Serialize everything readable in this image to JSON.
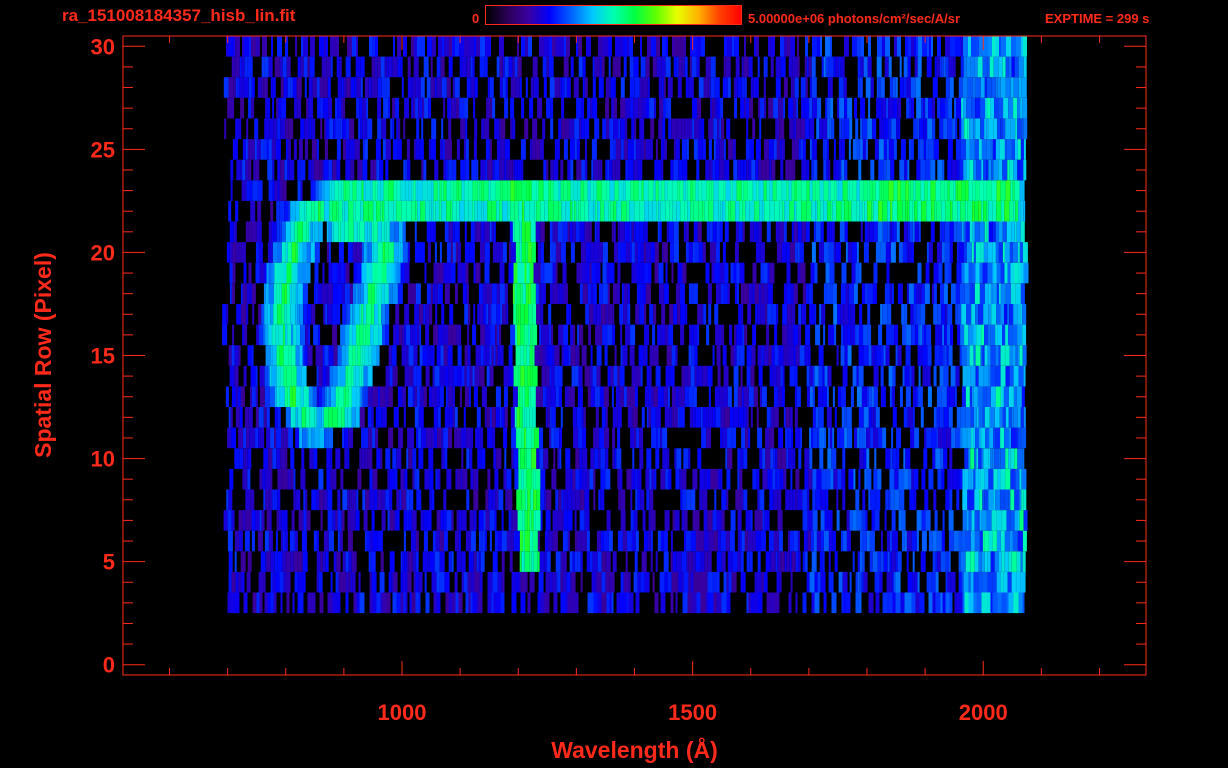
{
  "header": {
    "file_title": "ra_151008184357_hisb_lin.fit",
    "colorbar_min": "0",
    "colorbar_max": "5.00000e+06 photons/cm²/sec/A/sr",
    "exptime": "EXPTIME = 299 s"
  },
  "colors": {
    "axis": "#ff2a1a",
    "background": "#000000",
    "colormap": [
      "#000000",
      "#2a0055",
      "#3a00a0",
      "#0000ff",
      "#0060ff",
      "#00c8ff",
      "#00ffb0",
      "#00ff40",
      "#60ff00",
      "#e8ff00",
      "#ffb000",
      "#ff4000",
      "#ff0000"
    ]
  },
  "chart_data": {
    "type": "heatmap",
    "xlabel": "Wavelength (Å)",
    "ylabel": "Spatial Row (Pixel)",
    "xlim": [
      520,
      2280
    ],
    "ylim": [
      -0.5,
      30.5
    ],
    "x_ticks": [
      1000,
      1500,
      2000
    ],
    "y_ticks": [
      0,
      5,
      10,
      15,
      20,
      25,
      30
    ],
    "x_tick_labels": [
      "1000",
      "1500",
      "2000"
    ],
    "y_tick_labels": [
      "0",
      "5",
      "10",
      "15",
      "20",
      "25",
      "30"
    ],
    "value_range": [
      0,
      5000000
    ],
    "data_extent_x": [
      690,
      2070
    ],
    "data_rows": [
      3,
      30
    ],
    "features": [
      {
        "label": "horizontal bright band",
        "row": 22.5,
        "x": [
          870,
          2060
        ],
        "intensity": 0.5
      },
      {
        "label": "vertical bright band",
        "x": 1210,
        "rows": [
          5,
          23
        ],
        "intensity": 0.55
      },
      {
        "label": "curved loop",
        "points": [
          [
            900,
            23
          ],
          [
            830,
            21.5
          ],
          [
            800,
            19
          ],
          [
            790,
            16
          ],
          [
            800,
            13.5
          ],
          [
            845,
            11.5
          ],
          [
            890,
            12
          ],
          [
            930,
            16
          ],
          [
            975,
            20.5
          ],
          [
            900,
            21
          ]
        ],
        "intensity": 0.55
      },
      {
        "label": "bright right edge",
        "x": [
          1960,
          2070
        ],
        "rows": [
          2,
          30
        ],
        "intensity": 0.45
      }
    ]
  }
}
